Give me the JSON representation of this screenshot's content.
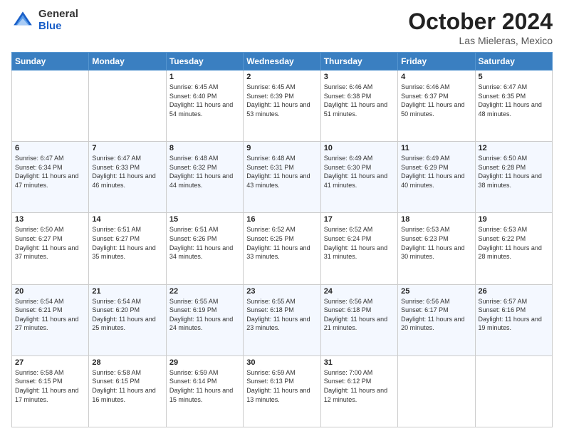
{
  "header": {
    "logo_general": "General",
    "logo_blue": "Blue",
    "title": "October 2024",
    "subtitle": "Las Mieleras, Mexico"
  },
  "weekdays": [
    "Sunday",
    "Monday",
    "Tuesday",
    "Wednesday",
    "Thursday",
    "Friday",
    "Saturday"
  ],
  "weeks": [
    [
      {
        "day": "",
        "info": ""
      },
      {
        "day": "",
        "info": ""
      },
      {
        "day": "1",
        "info": "Sunrise: 6:45 AM\nSunset: 6:40 PM\nDaylight: 11 hours and 54 minutes."
      },
      {
        "day": "2",
        "info": "Sunrise: 6:45 AM\nSunset: 6:39 PM\nDaylight: 11 hours and 53 minutes."
      },
      {
        "day": "3",
        "info": "Sunrise: 6:46 AM\nSunset: 6:38 PM\nDaylight: 11 hours and 51 minutes."
      },
      {
        "day": "4",
        "info": "Sunrise: 6:46 AM\nSunset: 6:37 PM\nDaylight: 11 hours and 50 minutes."
      },
      {
        "day": "5",
        "info": "Sunrise: 6:47 AM\nSunset: 6:35 PM\nDaylight: 11 hours and 48 minutes."
      }
    ],
    [
      {
        "day": "6",
        "info": "Sunrise: 6:47 AM\nSunset: 6:34 PM\nDaylight: 11 hours and 47 minutes."
      },
      {
        "day": "7",
        "info": "Sunrise: 6:47 AM\nSunset: 6:33 PM\nDaylight: 11 hours and 46 minutes."
      },
      {
        "day": "8",
        "info": "Sunrise: 6:48 AM\nSunset: 6:32 PM\nDaylight: 11 hours and 44 minutes."
      },
      {
        "day": "9",
        "info": "Sunrise: 6:48 AM\nSunset: 6:31 PM\nDaylight: 11 hours and 43 minutes."
      },
      {
        "day": "10",
        "info": "Sunrise: 6:49 AM\nSunset: 6:30 PM\nDaylight: 11 hours and 41 minutes."
      },
      {
        "day": "11",
        "info": "Sunrise: 6:49 AM\nSunset: 6:29 PM\nDaylight: 11 hours and 40 minutes."
      },
      {
        "day": "12",
        "info": "Sunrise: 6:50 AM\nSunset: 6:28 PM\nDaylight: 11 hours and 38 minutes."
      }
    ],
    [
      {
        "day": "13",
        "info": "Sunrise: 6:50 AM\nSunset: 6:27 PM\nDaylight: 11 hours and 37 minutes."
      },
      {
        "day": "14",
        "info": "Sunrise: 6:51 AM\nSunset: 6:27 PM\nDaylight: 11 hours and 35 minutes."
      },
      {
        "day": "15",
        "info": "Sunrise: 6:51 AM\nSunset: 6:26 PM\nDaylight: 11 hours and 34 minutes."
      },
      {
        "day": "16",
        "info": "Sunrise: 6:52 AM\nSunset: 6:25 PM\nDaylight: 11 hours and 33 minutes."
      },
      {
        "day": "17",
        "info": "Sunrise: 6:52 AM\nSunset: 6:24 PM\nDaylight: 11 hours and 31 minutes."
      },
      {
        "day": "18",
        "info": "Sunrise: 6:53 AM\nSunset: 6:23 PM\nDaylight: 11 hours and 30 minutes."
      },
      {
        "day": "19",
        "info": "Sunrise: 6:53 AM\nSunset: 6:22 PM\nDaylight: 11 hours and 28 minutes."
      }
    ],
    [
      {
        "day": "20",
        "info": "Sunrise: 6:54 AM\nSunset: 6:21 PM\nDaylight: 11 hours and 27 minutes."
      },
      {
        "day": "21",
        "info": "Sunrise: 6:54 AM\nSunset: 6:20 PM\nDaylight: 11 hours and 25 minutes."
      },
      {
        "day": "22",
        "info": "Sunrise: 6:55 AM\nSunset: 6:19 PM\nDaylight: 11 hours and 24 minutes."
      },
      {
        "day": "23",
        "info": "Sunrise: 6:55 AM\nSunset: 6:18 PM\nDaylight: 11 hours and 23 minutes."
      },
      {
        "day": "24",
        "info": "Sunrise: 6:56 AM\nSunset: 6:18 PM\nDaylight: 11 hours and 21 minutes."
      },
      {
        "day": "25",
        "info": "Sunrise: 6:56 AM\nSunset: 6:17 PM\nDaylight: 11 hours and 20 minutes."
      },
      {
        "day": "26",
        "info": "Sunrise: 6:57 AM\nSunset: 6:16 PM\nDaylight: 11 hours and 19 minutes."
      }
    ],
    [
      {
        "day": "27",
        "info": "Sunrise: 6:58 AM\nSunset: 6:15 PM\nDaylight: 11 hours and 17 minutes."
      },
      {
        "day": "28",
        "info": "Sunrise: 6:58 AM\nSunset: 6:15 PM\nDaylight: 11 hours and 16 minutes."
      },
      {
        "day": "29",
        "info": "Sunrise: 6:59 AM\nSunset: 6:14 PM\nDaylight: 11 hours and 15 minutes."
      },
      {
        "day": "30",
        "info": "Sunrise: 6:59 AM\nSunset: 6:13 PM\nDaylight: 11 hours and 13 minutes."
      },
      {
        "day": "31",
        "info": "Sunrise: 7:00 AM\nSunset: 6:12 PM\nDaylight: 11 hours and 12 minutes."
      },
      {
        "day": "",
        "info": ""
      },
      {
        "day": "",
        "info": ""
      }
    ]
  ]
}
